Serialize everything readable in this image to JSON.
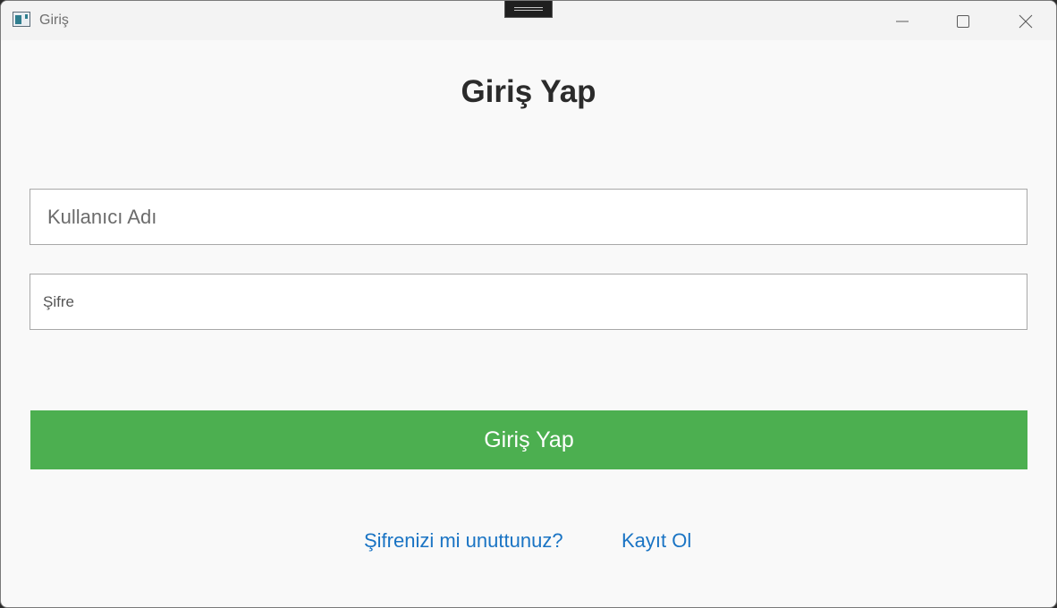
{
  "window": {
    "title": "Giriş",
    "app_icon": "window-app-icon",
    "controls": {
      "minimize": "minimize-icon",
      "maximize": "maximize-icon",
      "close": "close-icon"
    }
  },
  "form": {
    "heading": "Giriş Yap",
    "username": {
      "value": "",
      "placeholder": "Kullanıcı Adı"
    },
    "password": {
      "value": "",
      "placeholder": "Şifre"
    },
    "submit_label": "Giriş Yap",
    "links": {
      "forgot_password": "Şifrenizi mi unuttunuz?",
      "register": "Kayıt Ol"
    }
  },
  "colors": {
    "submit_button": "#4caf50",
    "link": "#1a74c4",
    "background": "#f9f9f9",
    "titlebar": "#f3f3f3"
  }
}
